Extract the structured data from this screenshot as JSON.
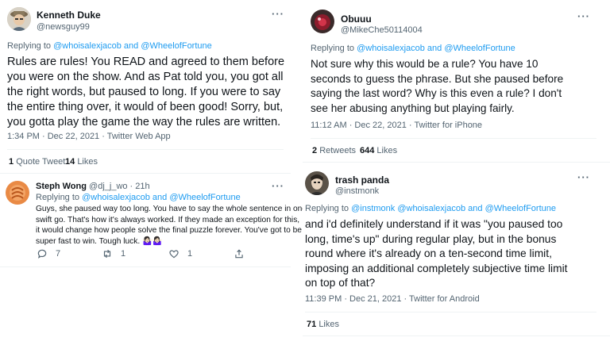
{
  "left": {
    "tweet1": {
      "name": "Kenneth Duke",
      "handle": "@newsguy99",
      "more": "···",
      "replying_prefix": "Replying to ",
      "replying_to": "@whoisalexjacob and @WheelofFortune",
      "lines": [
        "Rules are rules!  You READ and agreed to them before",
        "you were on the show.  And as Pat told you, you got all",
        "the right words, but paused to long.  If you were to say",
        "the entire thing over, it would of been good!  Sorry, but,",
        "you gotta play the game the way the rules are written."
      ],
      "timestamp": "1:34 PM · Dec 22, 2021 · Twitter Web App",
      "quote_count": "1",
      "quote_label": "Quote Tweet",
      "likes_count": "14",
      "likes_label": "Likes"
    },
    "tweet2": {
      "name": "Steph Wong",
      "handle": "@dj_j_wo · 21h",
      "more": "···",
      "replying_prefix": "Replying to ",
      "replying_to": "@whoisalexjacob and @WheelofFortune",
      "lines": [
        "Guys, she paused way too long. You have to say the whole sentence in one",
        "swift go. That's how it's always worked. If they made an exception for this,",
        "it would change how people solve the final puzzle forever. You've got to be",
        "super fast to win. Tough luck. 🤷🏻‍♀️🤷🏻‍♀️"
      ],
      "replies": "7",
      "retweets": "1",
      "likes": "1"
    }
  },
  "right": {
    "tweet1": {
      "name": "Obuuu",
      "handle": "@MikeChe50114004",
      "more": "···",
      "replying_prefix": "Replying to ",
      "replying_to": "@whoisalexjacob and @WheelofFortune",
      "lines": [
        "Not sure why this would be a rule?  You have 10",
        "seconds to guess the phrase.  But she paused before",
        "saying the last word?  Why is this even a rule?  I don't",
        "see her abusing anything but playing fairly."
      ],
      "timestamp": "11:12 AM · Dec 22, 2021 · Twitter for iPhone",
      "retweets_count": "2",
      "retweets_label": "Retweets",
      "likes_count": "644",
      "likes_label": "Likes"
    },
    "tweet2": {
      "name": "trash panda",
      "handle": "@instmonk",
      "more": "···",
      "replying_prefix": "Replying to ",
      "replying_to": "@instmonk @whoisalexjacob and @WheelofFortune",
      "lines": [
        "and i'd definitely understand if it was \"you paused too",
        "long, time's up\" during regular play, but in the bonus",
        "round where it's already on a ten-second time limit,",
        "imposing an additional completely subjective time limit",
        "on top of that?"
      ],
      "timestamp": "11:39 PM · Dec 21, 2021 · Twitter for Android",
      "likes_count": "71",
      "likes_label": "Likes"
    }
  }
}
